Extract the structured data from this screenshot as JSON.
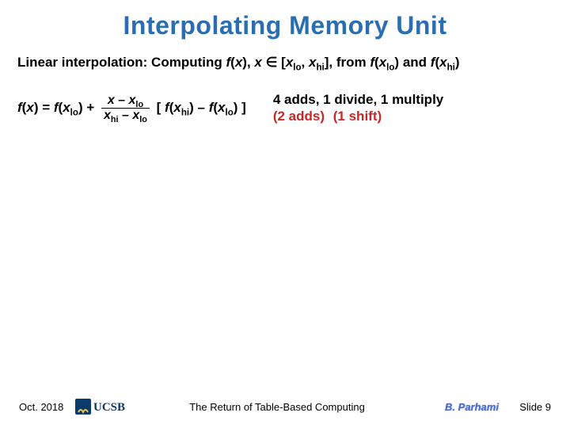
{
  "title": "Interpolating Memory Unit",
  "subtitle": {
    "lead": "Linear interpolation: Computing ",
    "fx": "f",
    "x": "x",
    "mid": ", ",
    "inset": " ∈ [",
    "xlo": "x",
    "lo": "lo",
    "sep1": ", ",
    "xhi": "x",
    "hi": "hi",
    "close": "], from ",
    "fxlo_f": "f",
    "fxlo_x": "x",
    "and": " and ",
    "fxhi_f": "f",
    "fxhi_x": "x",
    "end": ""
  },
  "formula": {
    "lhs_f": "f",
    "lhs_x": "x",
    "eq": "  =  ",
    "t1_f": "f",
    "t1_x": "x",
    "plus": " + ",
    "num_x": "x",
    "num_minus": " – ",
    "num_xlo": "x",
    "den_xhi": "x",
    "den_minus": " – ",
    "den_xlo": "x",
    "bracket_open": " [ ",
    "t2_f": "f",
    "t2_x": "x",
    "minus2": " – ",
    "t3_f": "f",
    "t3_x": "x",
    "bracket_close": " ]"
  },
  "cost": {
    "line1": "4 adds, 1 divide, 1 multiply",
    "line2a": "(2 adds)",
    "line2b": "(1 shift)"
  },
  "footer": {
    "date": "Oct. 2018",
    "center": "The Return of Table-Based Computing",
    "author": "B. Parhami",
    "slidenum": "Slide 9",
    "logo_text": "UCSB"
  }
}
